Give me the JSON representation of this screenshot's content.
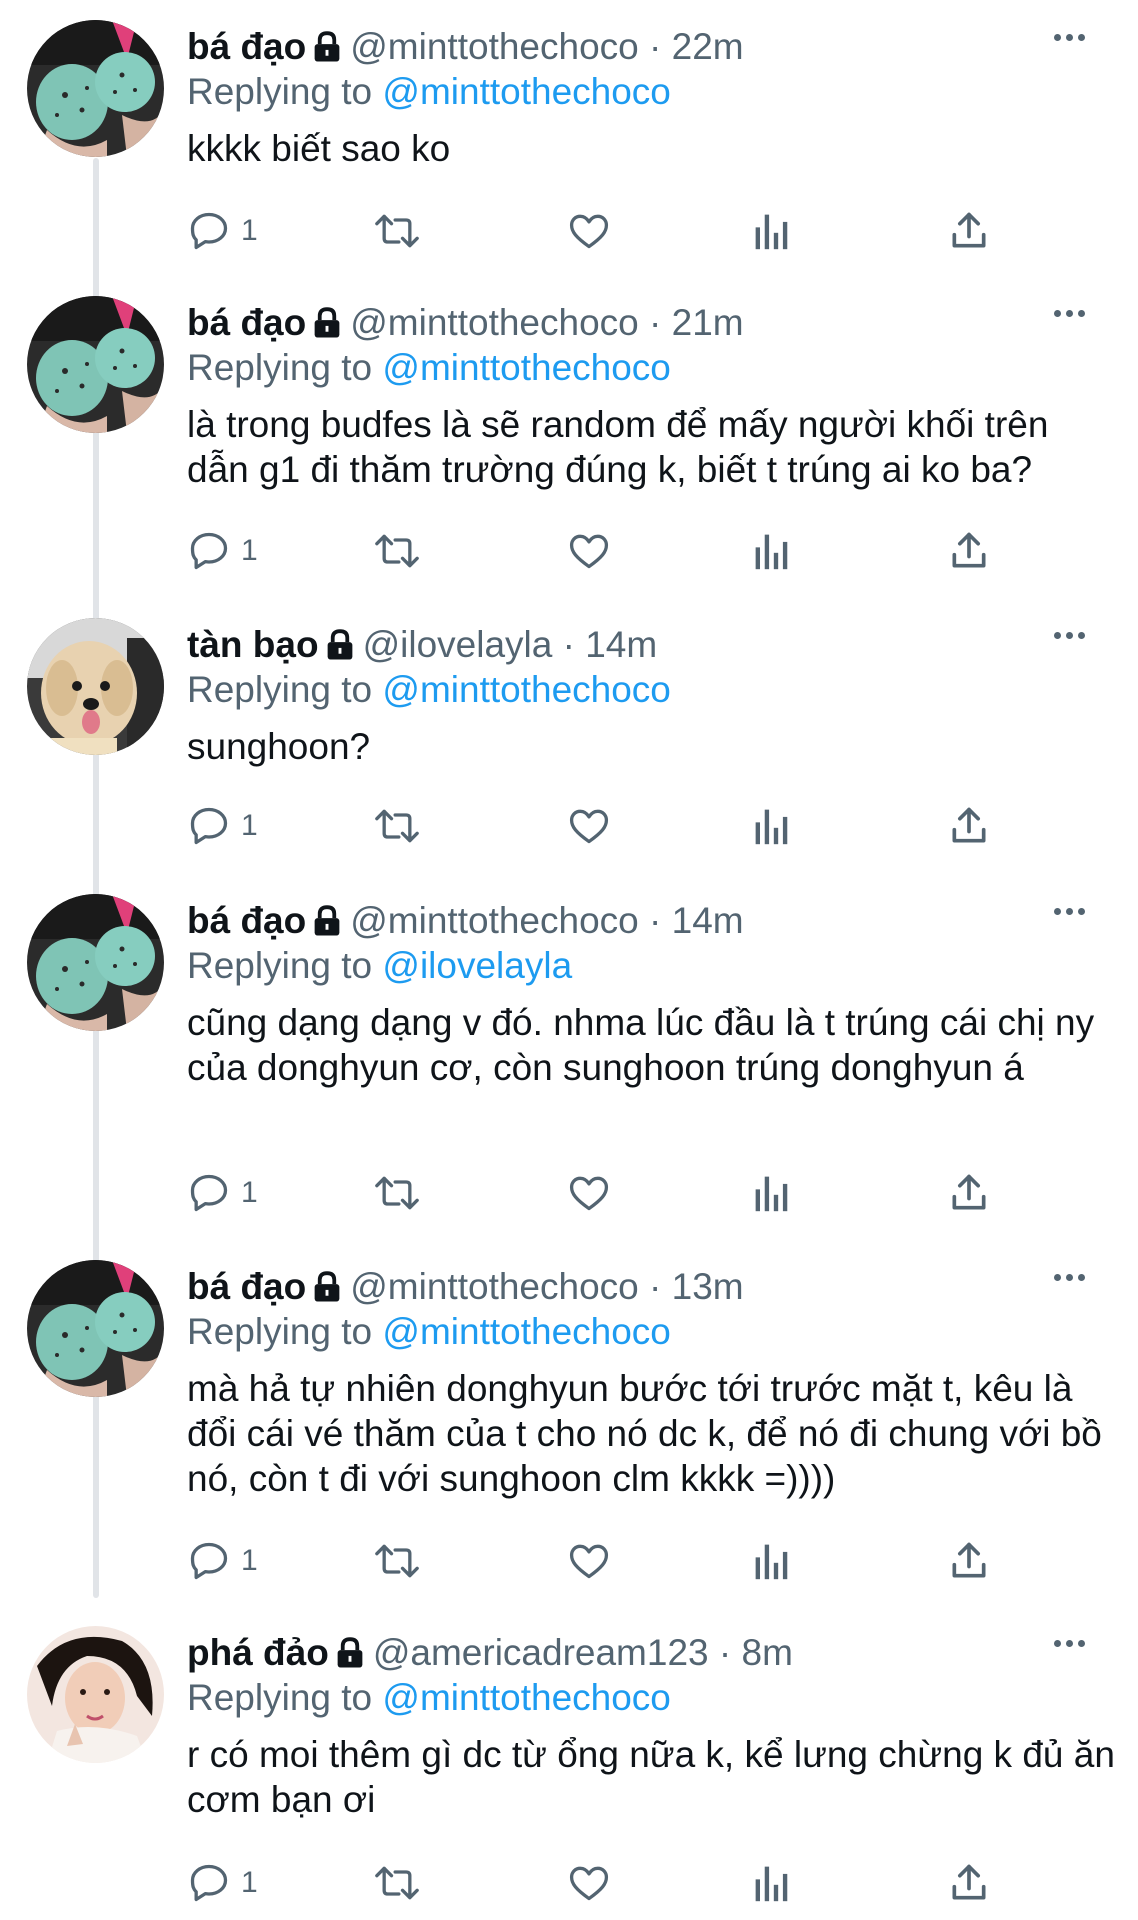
{
  "colors": {
    "link": "#1d9bf0",
    "muted": "#536471",
    "text": "#0f1419",
    "thread_line": "#e1e4e8"
  },
  "tweets": [
    {
      "name": "bá đạo",
      "handle": "@minttothechoco",
      "sep": "·",
      "time": "22m",
      "replying_prefix": "Replying to",
      "replying_to": "@minttothechoco",
      "text": "kkkk biết sao ko",
      "reply_count": "1",
      "avatar": "mint-icecream"
    },
    {
      "name": "bá đạo",
      "handle": "@minttothechoco",
      "sep": "·",
      "time": "21m",
      "replying_prefix": "Replying to",
      "replying_to": "@minttothechoco",
      "text": "là trong budfes là sẽ random để mấy người khối trên dẫn g1 đi thăm trường đúng k, biết t trúng ai ko ba?",
      "reply_count": "1",
      "avatar": "mint-icecream"
    },
    {
      "name": "tàn bạo",
      "handle": "@ilovelayla",
      "sep": "·",
      "time": "14m",
      "replying_prefix": "Replying to",
      "replying_to": "@minttothechoco",
      "text": "sunghoon?",
      "reply_count": "1",
      "avatar": "dog"
    },
    {
      "name": "bá đạo",
      "handle": "@minttothechoco",
      "sep": "·",
      "time": "14m",
      "replying_prefix": "Replying to",
      "replying_to": "@ilovelayla",
      "text": "cũng dạng dạng v đó. nhma lúc đầu là t trúng cái chị ny của donghyun cơ, còn sunghoon trúng donghyun á",
      "reply_count": "1",
      "avatar": "mint-icecream"
    },
    {
      "name": "bá đạo",
      "handle": "@minttothechoco",
      "sep": "·",
      "time": "13m",
      "replying_prefix": "Replying to",
      "replying_to": "@minttothechoco",
      "text": "mà hả tự nhiên donghyun bước tới trước mặt t, kêu là đổi cái vé thăm của t cho nó dc k, để nó đi chung với bồ nó, còn t đi với sunghoon clm kkkk =))))",
      "reply_count": "1",
      "avatar": "mint-icecream"
    },
    {
      "name": "phá đảo",
      "handle": "@americadream123",
      "sep": "·",
      "time": "8m",
      "replying_prefix": "Replying to",
      "replying_to": "@minttothechoco",
      "text": "r có moi thêm gì dc từ ổng nữa k, kể lưng chừng k đủ ăn cơm bạn ơi",
      "reply_count": "1",
      "avatar": "girl-photo"
    }
  ]
}
